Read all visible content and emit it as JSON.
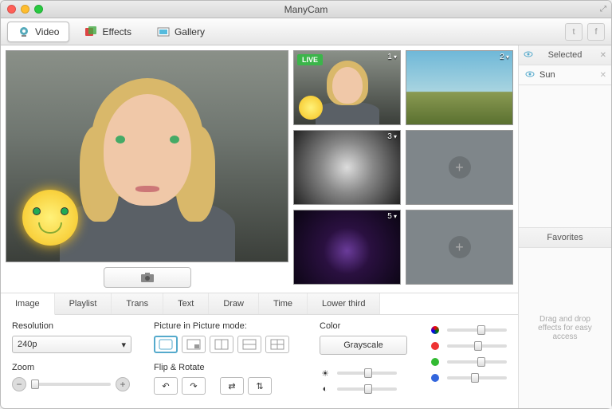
{
  "title": "ManyCam",
  "tabs": {
    "video": "Video",
    "effects": "Effects",
    "gallery": "Gallery"
  },
  "live": "LIVE",
  "sources": [
    {
      "num": "1",
      "kind": "webcam",
      "live": true
    },
    {
      "num": "2",
      "kind": "sky"
    },
    {
      "num": "3",
      "kind": "tunnel"
    },
    {
      "kind": "empty"
    },
    {
      "num": "5",
      "kind": "space"
    },
    {
      "kind": "empty"
    }
  ],
  "control_tabs": [
    "Image",
    "Playlist",
    "Trans",
    "Text",
    "Draw",
    "Time",
    "Lower third"
  ],
  "labels": {
    "resolution": "Resolution",
    "pip": "Picture in Picture mode:",
    "color": "Color",
    "zoom": "Zoom",
    "flip": "Flip & Rotate"
  },
  "resolution_value": "240p",
  "grayscale": "Grayscale",
  "sidebar": {
    "selected": "Selected",
    "item": "Sun",
    "favorites": "Favorites",
    "hint": "Drag and drop effects for easy access"
  },
  "sliders": {
    "brightness": 50,
    "contrast": 50,
    "rgb": 55,
    "red": 50,
    "green": 55,
    "blue": 45
  }
}
